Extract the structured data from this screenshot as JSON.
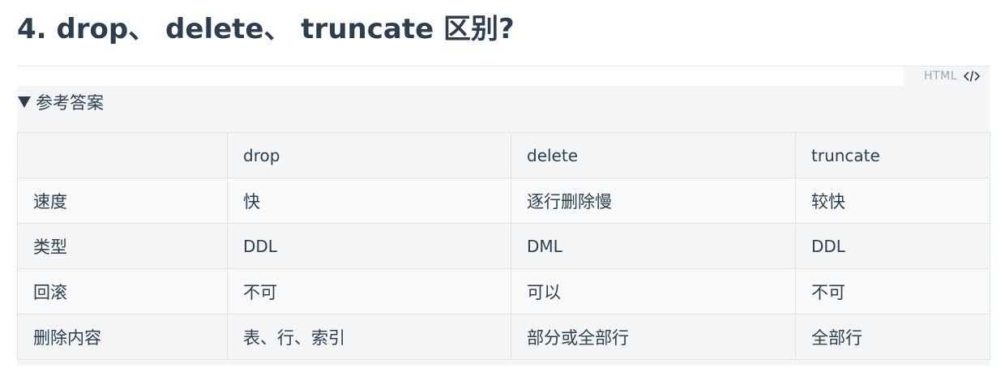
{
  "heading": "4. drop、 delete、 truncate 区别?",
  "code_block": {
    "lang_label": "HTML",
    "icon": "code-icon"
  },
  "details": {
    "summary": "参考答案",
    "icon": "triangle-down-icon"
  },
  "table": {
    "headers": [
      "",
      "drop",
      "delete",
      "truncate"
    ],
    "rows": [
      [
        "速度",
        "快",
        "逐行删除慢",
        "较快"
      ],
      [
        "类型",
        "DDL",
        "DML",
        "DDL"
      ],
      [
        "回滚",
        "不可",
        "可以",
        "不可"
      ],
      [
        "删除内容",
        "表、行、索引",
        "部分或全部行",
        "全部行"
      ]
    ]
  }
}
